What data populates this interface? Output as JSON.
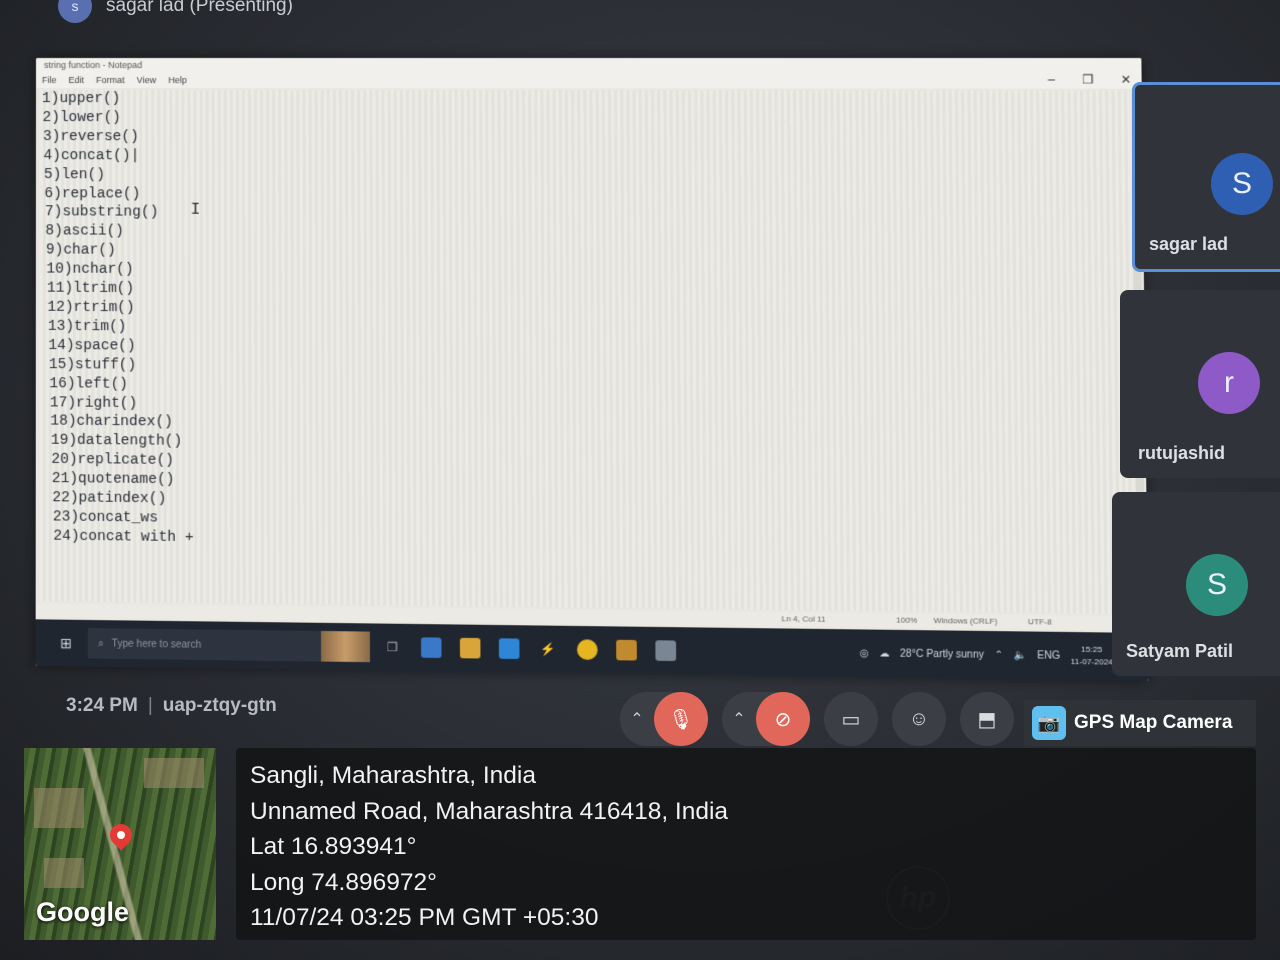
{
  "presenter": {
    "avatar_letter": "s",
    "label": "sagar lad (Presenting)"
  },
  "notepad": {
    "title": "string function - Notepad",
    "menu": [
      "File",
      "Edit",
      "Format",
      "View",
      "Help"
    ],
    "lines": [
      "1)upper()",
      "2)lower()",
      "3)reverse()",
      "4)concat()|",
      "5)len()",
      "6)replace()",
      "7)substring()",
      "8)ascii()",
      "9)char()",
      "10)nchar()",
      "11)ltrim()",
      "12)rtrim()",
      "13)trim()",
      "14)space()",
      "15)stuff()",
      "16)left()",
      "17)right()",
      "18)charindex()",
      "19)datalength()",
      "20)replicate()",
      "21)quotename()",
      "22)patindex()",
      "23)concat_ws",
      "24)concat with +"
    ],
    "status": {
      "position": "Ln 4, Col 11",
      "zoom": "100%",
      "eol": "Windows (CRLF)",
      "encoding": "UTF-8"
    }
  },
  "taskbar": {
    "search_placeholder": "Type here to search",
    "weather": "28°C  Partly sunny",
    "language": "ENG",
    "time": "15:25",
    "date": "11-07-2024"
  },
  "participants": [
    {
      "letter": "S",
      "name": "sagar lad",
      "color": "#2f5fb3",
      "active": true
    },
    {
      "letter": "r",
      "name": "rutujashid",
      "color": "#8e5ac8",
      "active": false
    },
    {
      "letter": "S",
      "name": "Satyam Patil",
      "color": "#2c8c7c",
      "active": false
    }
  ],
  "meeting": {
    "time": "3:24 PM",
    "separator": "|",
    "code": "uap-ztqy-gtn"
  },
  "gps": {
    "app_name": "GPS Map Camera",
    "map_brand": "Google",
    "lines": [
      "Sangli, Maharashtra, India",
      "Unnamed Road, Maharashtra 416418, India",
      "Lat 16.893941°",
      "Long 74.896972°",
      "11/07/24 03:25 PM GMT +05:30"
    ]
  },
  "hardware_logo": "hp"
}
